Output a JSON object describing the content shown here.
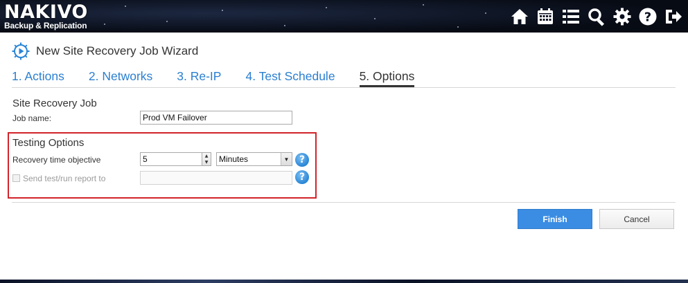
{
  "header": {
    "logo_main": "NAKIVO",
    "logo_sub": "Backup & Replication",
    "nav_icons": [
      "home-icon",
      "calendar-icon",
      "list-icon",
      "search-icon",
      "gear-icon",
      "help-icon",
      "logout-icon"
    ]
  },
  "wizard": {
    "title": "New Site Recovery Job Wizard",
    "tabs": [
      {
        "label": "1. Actions",
        "active": false
      },
      {
        "label": "2. Networks",
        "active": false
      },
      {
        "label": "3. Re-IP",
        "active": false
      },
      {
        "label": "4. Test Schedule",
        "active": false
      },
      {
        "label": "5. Options",
        "active": true
      }
    ]
  },
  "site_recovery_job": {
    "section_title": "Site Recovery Job",
    "job_name_label": "Job name:",
    "job_name_value": "Prod VM Failover"
  },
  "testing_options": {
    "section_title": "Testing Options",
    "rto_label": "Recovery time objective",
    "rto_value": "5",
    "rto_unit": "Minutes",
    "rto_help": "?",
    "report_label": "Send test/run report to",
    "report_checked": false,
    "report_value": "",
    "report_help": "?"
  },
  "footer": {
    "finish_label": "Finish",
    "cancel_label": "Cancel"
  },
  "colors": {
    "accent": "#2a7fd1",
    "primary_button": "#3b8de3",
    "highlight_border": "#d2232a"
  }
}
